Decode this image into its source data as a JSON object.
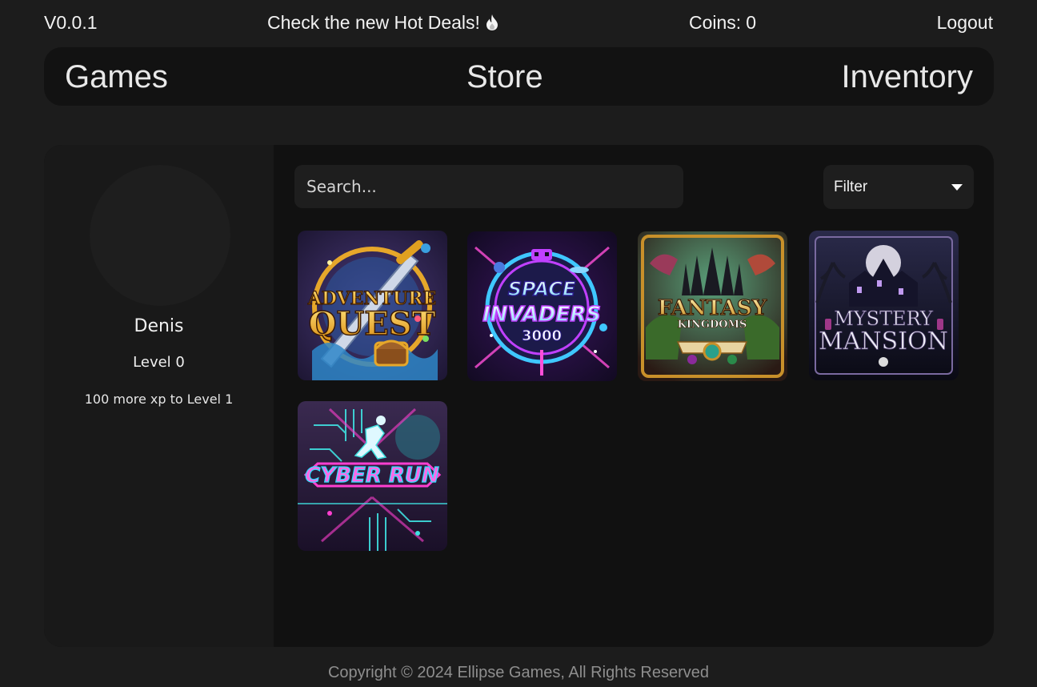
{
  "header": {
    "version": "V0.0.1",
    "deals_text": "Check the new Hot Deals!",
    "deals_icon": "flame-icon",
    "coins_label": "Coins:",
    "coins_value": "0",
    "logout_label": "Logout"
  },
  "nav": {
    "games": "Games",
    "store": "Store",
    "inventory": "Inventory"
  },
  "profile": {
    "name": "Denis",
    "level": "Level 0",
    "xp_text": "100 more xp to Level 1"
  },
  "search": {
    "placeholder": "Search..."
  },
  "filter": {
    "selected": "Filter"
  },
  "games": [
    {
      "line1": "ADVENTURE",
      "line2": "QUEST",
      "line3": ""
    },
    {
      "line1": "SPACE",
      "line2": "INVADERS",
      "line3": "3000"
    },
    {
      "line1": "FANTASY",
      "line2": "KINGDOMS",
      "line3": ""
    },
    {
      "line1": "MYSTERY",
      "line2": "MANSION",
      "line3": ""
    },
    {
      "line1": "CYBER RUN",
      "line2": "",
      "line3": ""
    }
  ],
  "footer": {
    "copyright": "Copyright © 2024 Ellipse Games, All Rights Reserved"
  },
  "colors": {
    "background": "#1c1c1c",
    "navbar": "#121212",
    "panel": "#111111",
    "profile_panel": "#191919",
    "input": "#1e1e1e",
    "footer_text": "#8e8e8e"
  }
}
